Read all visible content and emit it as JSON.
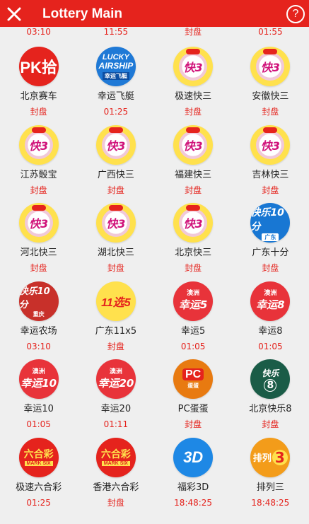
{
  "header": {
    "title": "Lottery Main",
    "help": "?"
  },
  "partial_row": [
    "03:10",
    "11:55",
    "封盘",
    "01:55"
  ],
  "lotteries": [
    {
      "name": "北京赛车",
      "status": "封盘",
      "icon": "pk10-icon",
      "icon_text": [
        "PK拾"
      ]
    },
    {
      "name": "幸运飞艇",
      "status": "01:25",
      "icon": "lucky-airship-icon",
      "icon_text": [
        "LUCKY",
        "AIRSHIP",
        "幸运飞艇"
      ]
    },
    {
      "name": "极速快三",
      "status": "封盘",
      "icon": "kuai3-icon",
      "icon_text": [
        "快3"
      ]
    },
    {
      "name": "安徽快三",
      "status": "封盘",
      "icon": "kuai3-icon",
      "icon_text": [
        "快3"
      ]
    },
    {
      "name": "江苏骰宝",
      "status": "封盘",
      "icon": "kuai3-icon",
      "icon_text": [
        "快3"
      ]
    },
    {
      "name": "广西快三",
      "status": "封盘",
      "icon": "kuai3-icon",
      "icon_text": [
        "快3"
      ]
    },
    {
      "name": "福建快三",
      "status": "封盘",
      "icon": "kuai3-icon",
      "icon_text": [
        "快3"
      ]
    },
    {
      "name": "吉林快三",
      "status": "封盘",
      "icon": "kuai3-icon",
      "icon_text": [
        "快3"
      ]
    },
    {
      "name": "河北快三",
      "status": "封盘",
      "icon": "kuai3-icon",
      "icon_text": [
        "快3"
      ]
    },
    {
      "name": "湖北快三",
      "status": "封盘",
      "icon": "kuai3-icon",
      "icon_text": [
        "快3"
      ]
    },
    {
      "name": "北京快三",
      "status": "封盘",
      "icon": "kuai3-icon",
      "icon_text": [
        "快3"
      ]
    },
    {
      "name": "广东十分",
      "status": "封盘",
      "icon": "guangdong-10-icon",
      "icon_text": [
        "快乐10分",
        "广东"
      ]
    },
    {
      "name": "幸运农场",
      "status": "03:10",
      "icon": "lucky-farm-icon",
      "icon_text": [
        "快乐10分",
        "重庆"
      ]
    },
    {
      "name": "广东11x5",
      "status": "封盘",
      "icon": "11x5-icon",
      "icon_text": [
        "11选5"
      ]
    },
    {
      "name": "幸运5",
      "status": "01:05",
      "icon": "lucky-5-icon",
      "icon_text": [
        "澳洲",
        "幸运5"
      ]
    },
    {
      "name": "幸运8",
      "status": "01:05",
      "icon": "lucky-8-icon",
      "icon_text": [
        "澳洲",
        "幸运8"
      ]
    },
    {
      "name": "幸运10",
      "status": "01:05",
      "icon": "lucky-10-icon",
      "icon_text": [
        "澳洲",
        "幸运10"
      ]
    },
    {
      "name": "幸运20",
      "status": "01:11",
      "icon": "lucky-20-icon",
      "icon_text": [
        "澳洲",
        "幸运20"
      ]
    },
    {
      "name": "PC蛋蛋",
      "status": "封盘",
      "icon": "pc-egg-icon",
      "icon_text": [
        "PC",
        "蛋蛋"
      ]
    },
    {
      "name": "北京快乐8",
      "status": "封盘",
      "icon": "bj-kl8-icon",
      "icon_text": [
        "快乐",
        "8"
      ]
    },
    {
      "name": "极速六合彩",
      "status": "01:25",
      "icon": "mark-six-icon",
      "icon_text": [
        "六合彩",
        "MARK SIX"
      ]
    },
    {
      "name": "香港六合彩",
      "status": "封盘",
      "icon": "mark-six-icon",
      "icon_text": [
        "六合彩",
        "MARK SIX"
      ]
    },
    {
      "name": "福彩3D",
      "status": "18:48:25",
      "icon": "fucai-3d-icon",
      "icon_text": [
        "3D"
      ]
    },
    {
      "name": "排列三",
      "status": "18:48:25",
      "icon": "pailie3-icon",
      "icon_text": [
        "排列",
        "3"
      ]
    }
  ]
}
